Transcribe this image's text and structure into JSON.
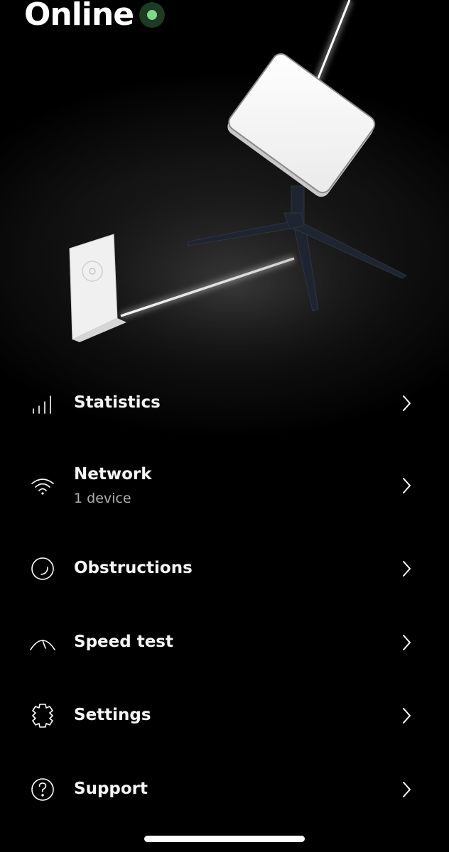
{
  "status": {
    "label": "Online",
    "indicator_color": "#7ed88a"
  },
  "hero": {
    "illustration": "starlink-dish-and-router-connected-by-light-beam"
  },
  "menu": {
    "items": [
      {
        "label": "Statistics",
        "icon": "bar-chart-icon"
      },
      {
        "label": "Network",
        "subtitle": "1 device",
        "icon": "wifi-icon"
      },
      {
        "label": "Obstructions",
        "icon": "obstruction-circle-icon"
      },
      {
        "label": "Speed test",
        "icon": "speedometer-icon"
      },
      {
        "label": "Settings",
        "icon": "gear-icon"
      },
      {
        "label": "Support",
        "icon": "question-circle-icon"
      }
    ]
  }
}
